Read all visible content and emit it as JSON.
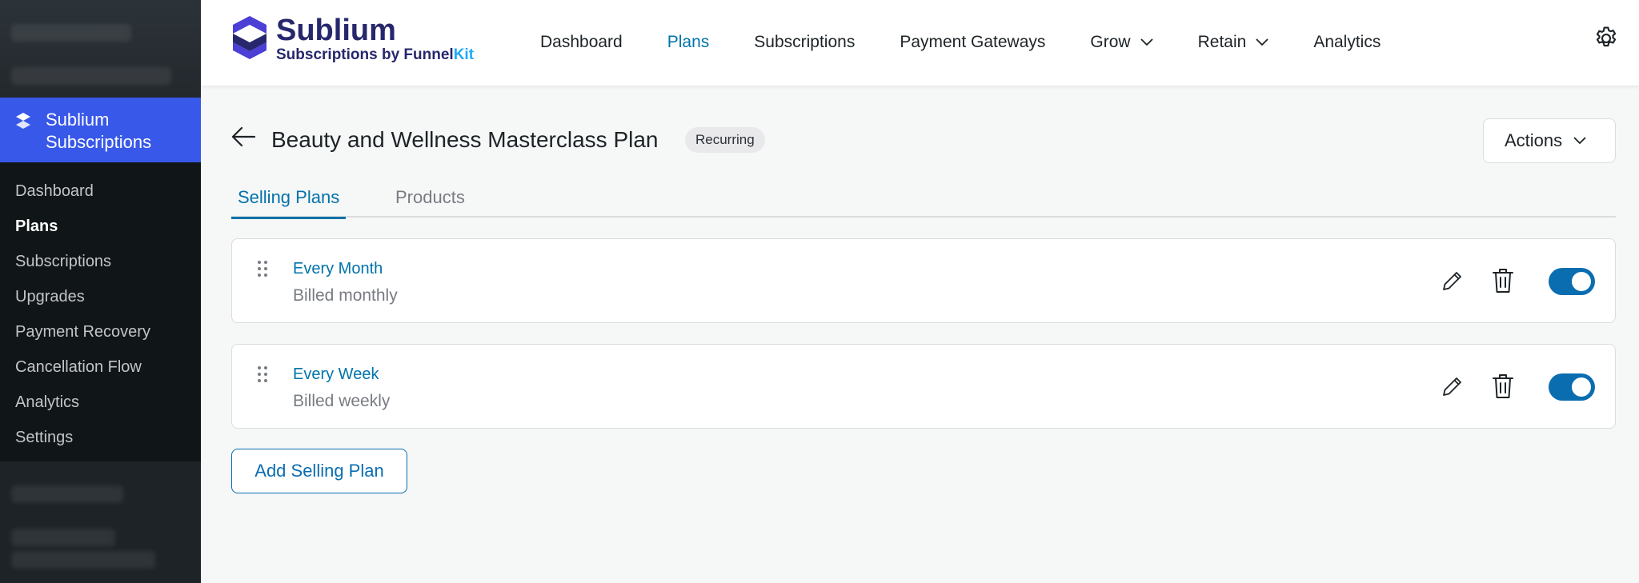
{
  "sidebar": {
    "active_menu": "Sublium Subscriptions",
    "items": [
      {
        "label": "Dashboard"
      },
      {
        "label": "Plans"
      },
      {
        "label": "Subscriptions"
      },
      {
        "label": "Upgrades"
      },
      {
        "label": "Payment Recovery"
      },
      {
        "label": "Cancellation Flow"
      },
      {
        "label": "Analytics"
      },
      {
        "label": "Settings"
      }
    ],
    "current_item": "Plans"
  },
  "brand": {
    "name": "Sublium",
    "sub_prefix": "Subscriptions by Funnel",
    "sub_suffix": "Kit",
    "icon": "sublium-logo",
    "color_primary": "#27276d",
    "color_accent": "#1daafc"
  },
  "nav": {
    "items": [
      {
        "label": "Dashboard",
        "active": false
      },
      {
        "label": "Plans",
        "active": true
      },
      {
        "label": "Subscriptions",
        "active": false
      },
      {
        "label": "Payment Gateways",
        "active": false
      },
      {
        "label": "Grow",
        "dropdown": true
      },
      {
        "label": "Retain",
        "dropdown": true
      },
      {
        "label": "Analytics",
        "active": false
      }
    ],
    "settings_icon": "gear-icon"
  },
  "page": {
    "title": "Beauty and Wellness Masterclass Plan",
    "badge": "Recurring",
    "actions_label": "Actions"
  },
  "tabs": [
    {
      "label": "Selling Plans",
      "selected": true
    },
    {
      "label": "Products",
      "selected": false
    }
  ],
  "selling_plans": [
    {
      "name": "Every Month",
      "description": "Billed monthly",
      "enabled": true
    },
    {
      "name": "Every Week",
      "description": "Billed weekly",
      "enabled": true
    }
  ],
  "add_button": "Add Selling Plan",
  "colors": {
    "accent": "#0073aa",
    "sidebar_active": "#3858e9",
    "toggle_on": "#0a6db0"
  }
}
